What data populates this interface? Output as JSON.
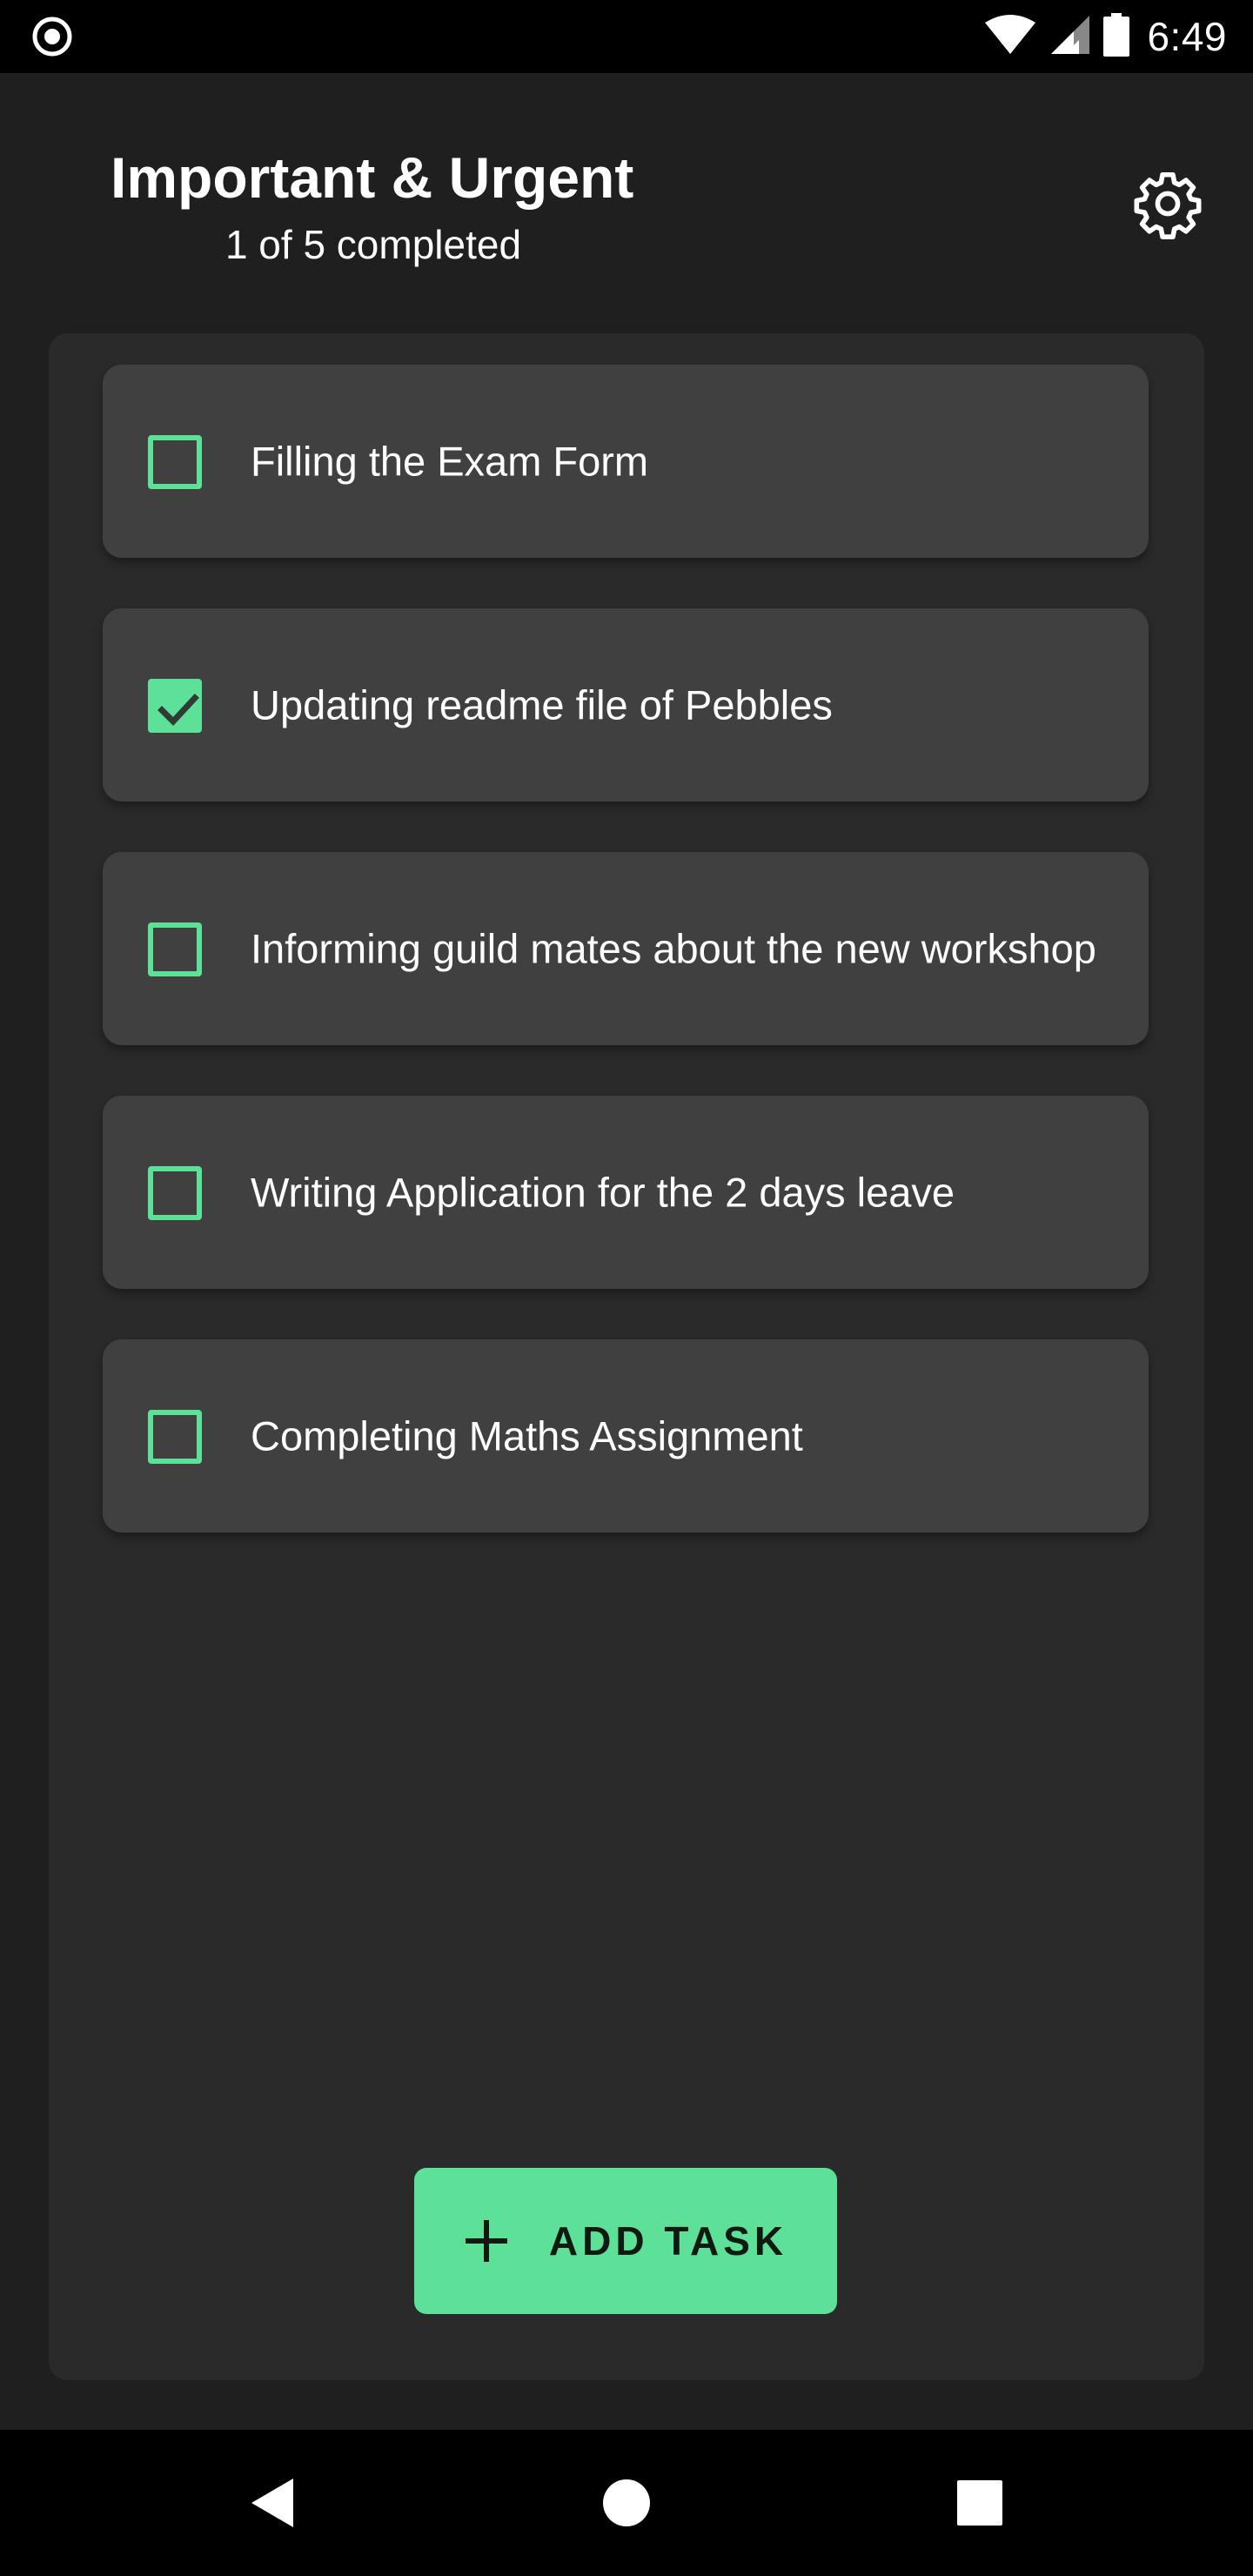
{
  "status_bar": {
    "time": "6:49",
    "icons": [
      "record-icon",
      "wifi-icon",
      "cellular-signal-icon",
      "battery-icon"
    ]
  },
  "header": {
    "title": "Important & Urgent",
    "subtitle": "1 of 5 completed",
    "settings_icon": "gear-icon"
  },
  "tasks": [
    {
      "label": "Filling the Exam Form",
      "completed": false
    },
    {
      "label": "Updating readme file of Pebbles",
      "completed": true
    },
    {
      "label": "Informing guild mates about the new workshop",
      "completed": false
    },
    {
      "label": "Writing Application for the 2 days leave",
      "completed": false
    },
    {
      "label": "Completing Maths Assignment",
      "completed": false
    }
  ],
  "add_button": {
    "label": "ADD TASK",
    "icon": "plus-icon"
  },
  "nav_bar": {
    "buttons": [
      "back-icon",
      "home-icon",
      "recents-icon"
    ]
  },
  "colors": {
    "accent": "#5de097",
    "background": "#1f1f1f",
    "card": "#2a2a2a",
    "task_card": "#404040"
  }
}
